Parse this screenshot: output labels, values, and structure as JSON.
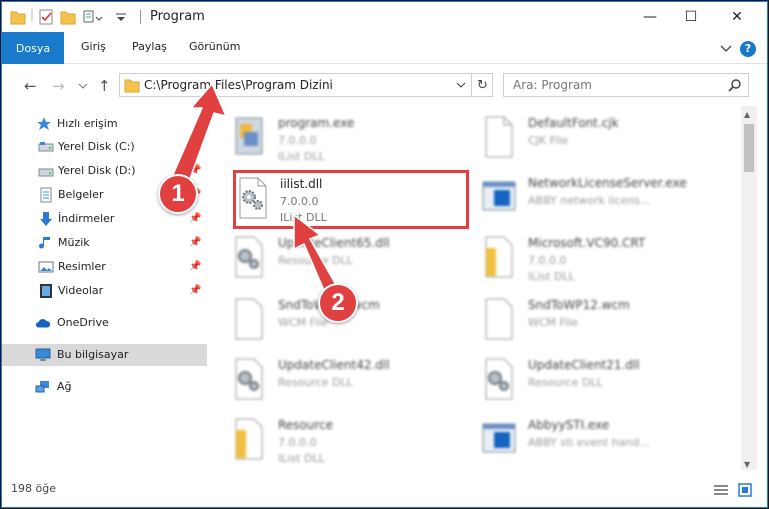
{
  "window": {
    "title": "Program",
    "minimize": "—",
    "maximize": "☐",
    "close": "✕"
  },
  "ribbon": {
    "file_tab": "Dosya",
    "tabs": [
      "Giriş",
      "Paylaş",
      "Görünüm"
    ]
  },
  "address": {
    "path": "C:\\Program Files\\Program Dizini",
    "search_placeholder": "Ara: Program"
  },
  "sidebar": {
    "items": [
      {
        "label": "Hızlı erişim",
        "icon": "star-icon"
      },
      {
        "label": "Yerel Disk (C:)",
        "icon": "drive-icon",
        "pinned": true
      },
      {
        "label": "Yerel Disk (D:)",
        "icon": "drive-icon",
        "pinned": true
      },
      {
        "label": "Belgeler",
        "icon": "documents-icon",
        "pinned": true
      },
      {
        "label": "İndirmeler",
        "icon": "download-icon",
        "pinned": true
      },
      {
        "label": "Müzik",
        "icon": "music-icon",
        "pinned": true
      },
      {
        "label": "Resimler",
        "icon": "pictures-icon",
        "pinned": true
      },
      {
        "label": "Videolar",
        "icon": "videos-icon",
        "pinned": true
      },
      {
        "label": "OneDrive",
        "icon": "cloud-icon"
      },
      {
        "label": "Bu bilgisayar",
        "icon": "computer-icon",
        "selected": true
      },
      {
        "label": "Ağ",
        "icon": "network-icon"
      }
    ]
  },
  "files": [
    {
      "name": "program.exe",
      "line2": "7.0.0.0",
      "line3": "IList DLL",
      "icon": "exe-icon"
    },
    {
      "name": "DefaultFont.cjk",
      "line2": "CJK File",
      "line3": "",
      "icon": "blank-file-icon"
    },
    {
      "name": "iilist.dll",
      "line2": "7.0.0.0",
      "line3": "IList DLL",
      "icon": "dll-gear-icon",
      "highlighted": true
    },
    {
      "name": "NetworkLicenseServer.exe",
      "line2": "ABBY network licens...",
      "line3": "",
      "icon": "exe-window-icon"
    },
    {
      "name": "UpdateClient65.dll",
      "line2": "Resource DLL",
      "line3": "",
      "icon": "dll-gear-icon"
    },
    {
      "name": "Microsoft.VC90.CRT",
      "line2": "7.0.0.0",
      "line3": "IList DLL",
      "icon": "folder-file-icon"
    },
    {
      "name": "SndToWP11.wcm",
      "line2": "WCM File",
      "line3": "",
      "icon": "blank-file-icon"
    },
    {
      "name": "SndToWP12.wcm",
      "line2": "WCM File",
      "line3": "",
      "icon": "blank-file-icon"
    },
    {
      "name": "UpdateClient42.dll",
      "line2": "Resource DLL",
      "line3": "",
      "icon": "dll-gear-icon"
    },
    {
      "name": "UpdateClient21.dll",
      "line2": "Resource DLL",
      "line3": "",
      "icon": "dll-gear-icon"
    },
    {
      "name": "Resource",
      "line2": "7.0.0.0",
      "line3": "IList DLL",
      "icon": "folder-file-icon"
    },
    {
      "name": "AbbyySTI.exe",
      "line2": "ABBY sti event hand...",
      "line3": "",
      "icon": "exe-window-icon"
    }
  ],
  "status": {
    "count": "198 öğe"
  },
  "annotations": {
    "badge1": "1",
    "badge2": "2",
    "color": "#e0403f"
  }
}
